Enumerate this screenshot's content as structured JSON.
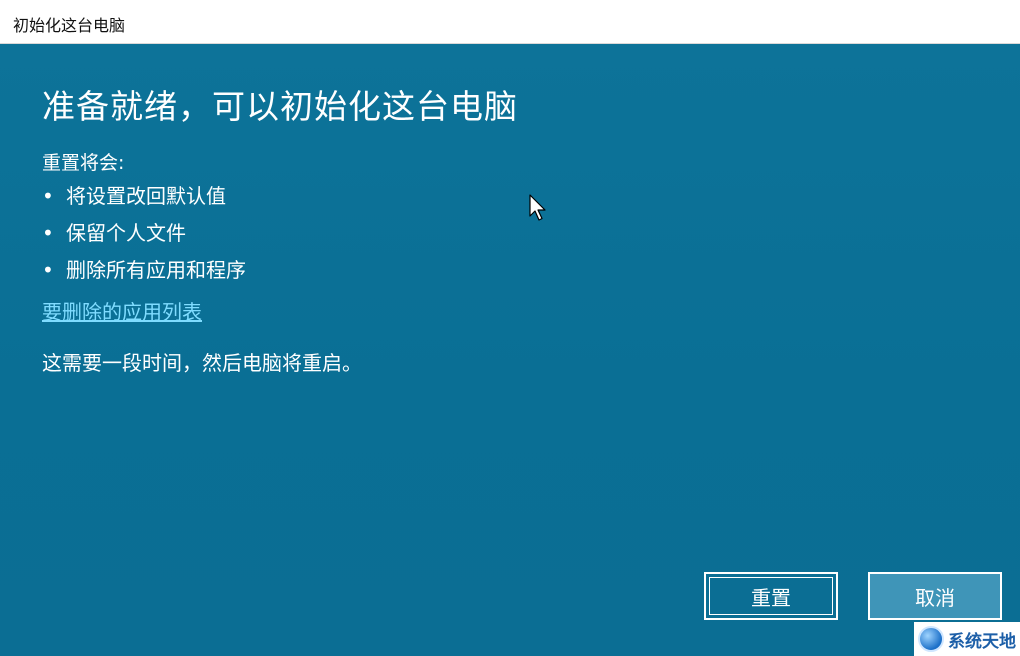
{
  "window": {
    "title": "初始化这台电脑"
  },
  "main": {
    "heading": "准备就绪，可以初始化这台电脑",
    "intro": "重置将会:",
    "bullets": [
      "将设置改回默认值",
      "保留个人文件",
      "删除所有应用和程序"
    ],
    "link": "要删除的应用列表",
    "note": "这需要一段时间，然后电脑将重启。"
  },
  "buttons": {
    "reset": "重置",
    "cancel": "取消"
  },
  "watermark": {
    "text": "系统天地"
  },
  "colors": {
    "background": "#0a6f96",
    "link": "#7fdcff",
    "titlebar": "#ffffff"
  }
}
